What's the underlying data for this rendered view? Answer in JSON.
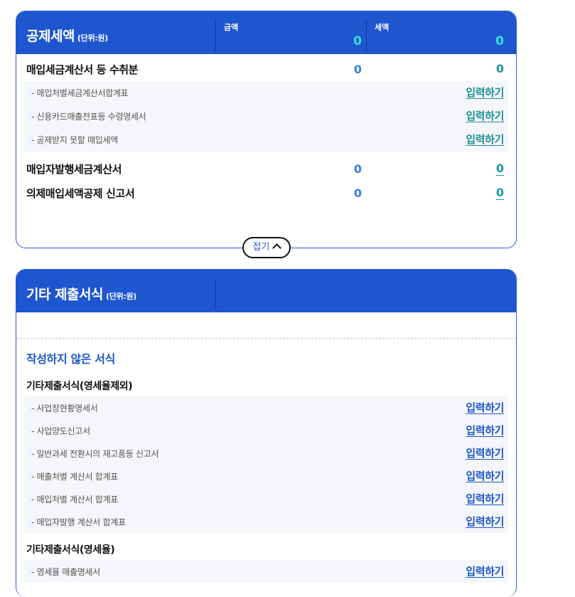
{
  "panel1": {
    "title": "공제세액",
    "unit": "(단위:원)",
    "col_amount_label": "금액",
    "col_tax_label": "세액",
    "header_amount": "0",
    "header_tax": "0",
    "row1": {
      "label": "매입세금계산서 등 수취분",
      "amount": "0",
      "tax": "0"
    },
    "sub_items": [
      {
        "label": "- 매입처별세금계산서합계표",
        "action": "입력하기"
      },
      {
        "label": "- 신용카드매출전표등 수령명세서",
        "action": "입력하기"
      },
      {
        "label": "- 공제받지 못할 매입세액",
        "action": "입력하기"
      }
    ],
    "row2": {
      "label": "매입자발행세금계산서",
      "amount": "0",
      "tax": "0"
    },
    "row3": {
      "label": "의제매입세액공제 신고서",
      "amount": "0",
      "tax": "0"
    },
    "collapse_label": "접기"
  },
  "panel2": {
    "title": "기타 제출서식",
    "unit": "(단위:원)",
    "section_title": "작성하지 않은 서식",
    "group1": {
      "title": "기타제출서식(영세율제외)",
      "items": [
        {
          "label": "- 사업장현황명세서",
          "action": "입력하기"
        },
        {
          "label": "- 사업양도신고서",
          "action": "입력하기"
        },
        {
          "label": "- 일반과세 전환시의 재고품등 신고서",
          "action": "입력하기"
        },
        {
          "label": "- 매출처별 계산서 합계표",
          "action": "입력하기"
        },
        {
          "label": "- 매입처별 계산서 합계표",
          "action": "입력하기"
        },
        {
          "label": "- 매입자발행 계산서 합계표",
          "action": "입력하기"
        }
      ]
    },
    "group2": {
      "title": "기타제출서식(영세율)",
      "items": [
        {
          "label": "- 영세율 매출명세서",
          "action": "입력하기"
        }
      ]
    }
  },
  "colors": {
    "header_blue": "#1e56d0",
    "header_value_cyan": "#34e3d6",
    "amount_blue": "#3a7bea",
    "tax_teal": "#1e9aa0",
    "link_blue": "#1d56c8"
  }
}
